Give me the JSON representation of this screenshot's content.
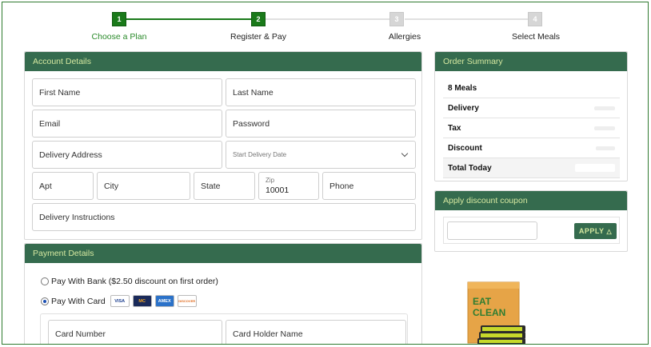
{
  "stepper": {
    "steps": [
      {
        "num": "1",
        "label": "Choose a Plan"
      },
      {
        "num": "2",
        "label": "Register & Pay"
      },
      {
        "num": "3",
        "label": "Allergies"
      },
      {
        "num": "4",
        "label": "Select Meals"
      }
    ],
    "colors": {
      "active": "#1a7a1a",
      "inactive": "#d6d6d6",
      "active_label": "#2a8a2a"
    }
  },
  "account": {
    "title": "Account Details",
    "first_name": "First Name",
    "last_name": "Last Name",
    "email": "Email",
    "password": "Password",
    "delivery_address": "Delivery Address",
    "start_date_label": "Start Delivery Date",
    "apt": "Apt",
    "city": "City",
    "state": "State",
    "zip_label": "Zip",
    "zip_value": "10001",
    "phone": "Phone",
    "delivery_instructions": "Delivery Instructions"
  },
  "payment": {
    "title": "Payment Details",
    "bank_option": "Pay With Bank ($2.50 discount on first order)",
    "card_option": "Pay With Card",
    "card_logos": [
      "VISA",
      "MC",
      "AMEX",
      "DISCOVER"
    ],
    "card_number": "Card Number",
    "card_holder": "Card Holder Name"
  },
  "summary": {
    "title": "Order Summary",
    "rows": [
      {
        "label": "8 Meals"
      },
      {
        "label": "Delivery"
      },
      {
        "label": "Tax"
      },
      {
        "label": "Discount"
      },
      {
        "label": "Total Today"
      }
    ]
  },
  "coupon": {
    "title": "Apply discount coupon",
    "button": "APPLY",
    "button_icon": "tag-icon"
  },
  "product": {
    "brand_line1": "EAT",
    "brand_line2": "CLEAN"
  },
  "theme": {
    "header_bg": "#356b4e",
    "header_text": "#d5e8a0",
    "border_green": "#2f7a2f"
  }
}
